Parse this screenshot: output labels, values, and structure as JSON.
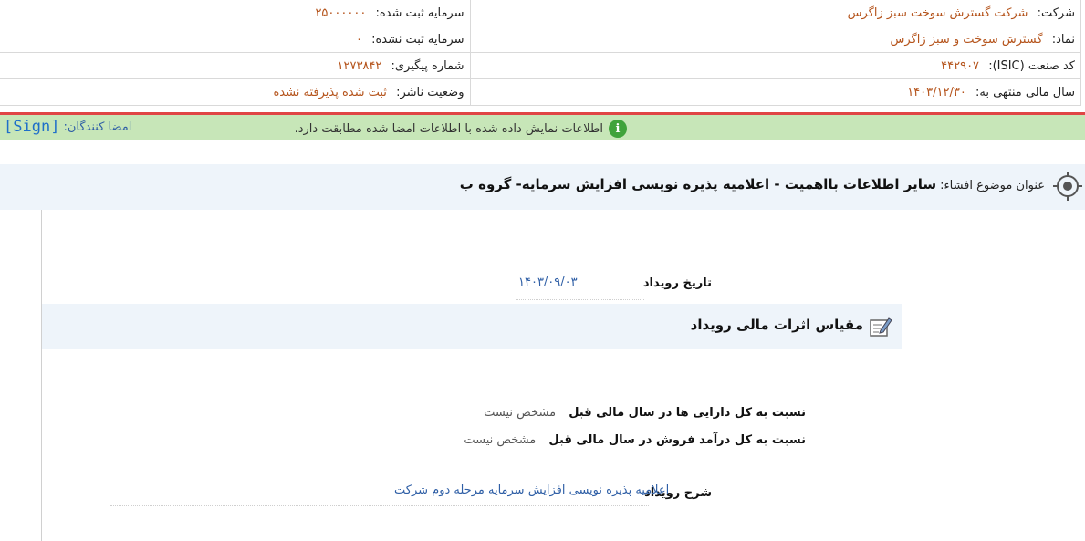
{
  "company_info": {
    "company_label": "شرکت:",
    "company_value": "شرکت گسترش سوخت سبز زاگرس",
    "symbol_label": "نماد:",
    "symbol_value": "گسترش سوخت و سبز زاگرس",
    "isic_label": "کد صنعت (ISIC):",
    "isic_value": "۴۴۲۹۰۷",
    "fiscal_year_label": "سال مالی منتهی به:",
    "fiscal_year_value": "۱۴۰۳/۱۲/۳۰",
    "registered_capital_label": "سرمایه ثبت شده:",
    "registered_capital_value": "۲۵۰۰۰۰۰۰",
    "unregistered_capital_label": "سرمایه ثبت نشده:",
    "unregistered_capital_value": "۰",
    "tracking_number_label": "شماره پیگیری:",
    "tracking_number_value": "۱۲۷۳۸۴۲",
    "publisher_status_label": "وضعیت ناشر:",
    "publisher_status_value": "ثبت شده پذیرفته نشده"
  },
  "notice": {
    "message": "اطلاعات نمایش داده شده با اطلاعات امضا شده مطابقت دارد.",
    "info_icon_glyph": "i",
    "signers_label": "امضا کنندگان:",
    "sign_link": "[Sign]"
  },
  "subject": {
    "label": "عنوان موضوع افشاء:",
    "title": "سایر اطلاعات بااهمیت - اعلامیه پذیره نویسی افزایش سرمایه- گروه ب",
    "icon": "target-icon"
  },
  "event": {
    "date_label": "تاریخ رویداد",
    "date_value": "۱۴۰۳/۰۹/۰۳",
    "section_title": "مقیاس اثرات مالی رویداد",
    "section_icon": "edit-note-icon",
    "ratio_assets_label": "نسبت به کل دارایی ها در سال مالی قبل",
    "ratio_assets_value": "مشخص نیست",
    "ratio_sales_label": "نسبت به کل درآمد فروش در سال مالی قبل",
    "ratio_sales_value": "مشخص نیست",
    "description_label": "شرح رویداد",
    "description_value": "اعلامیه پذیره نویسی افزایش سرمایه مرحله دوم شرکت"
  },
  "colors": {
    "value_text": "#b5541c",
    "link_blue": "#2f5fa6",
    "notice_bg": "#c7e6b8",
    "divider_red": "#e04545",
    "section_bg": "#eef4fa"
  }
}
